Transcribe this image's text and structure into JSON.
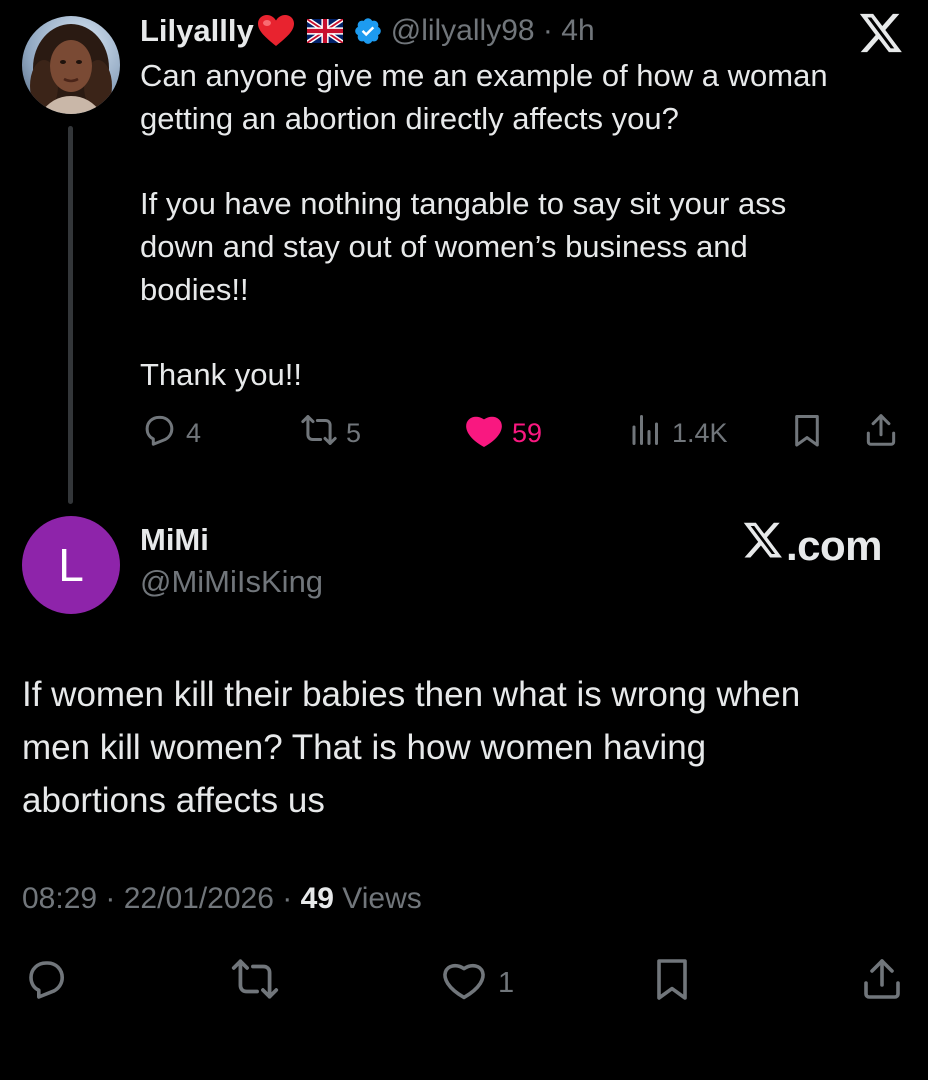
{
  "parent": {
    "display_name": "Lilyallly",
    "handle": "@lilyally98",
    "separator": "·",
    "time": "4h",
    "text_lines": [
      "Can anyone give me an example of how a woman",
      "getting an abortion directly affects you?",
      "If you have nothing tangable to say sit your ass",
      "down and stay out of women’s business and",
      "bodies!!",
      "Thank you!!"
    ],
    "replies": "4",
    "reposts": "5",
    "likes": "59",
    "views": "1.4K",
    "icons": {
      "verified": "verified-badge-icon",
      "flag": "uk-flag-icon",
      "heart": "red-heart-emoji-icon",
      "platform": "x-logo-icon"
    }
  },
  "reply": {
    "avatar_letter": "L",
    "display_name": "MiMi",
    "handle": "@MiMiIsKing",
    "watermark": ".com",
    "text_lines": [
      "If women kill their babies then what is wrong when",
      "men kill women? That is how women having",
      "abortions affects us"
    ],
    "time": "08:29",
    "date": "22/01/2026",
    "views_count": "49",
    "views_label": "Views",
    "likes": "1"
  },
  "colors": {
    "background": "#000000",
    "text": "#e7e9ea",
    "muted": "#71767b",
    "like_pink": "#f91880",
    "verified_blue": "#1d9bf0",
    "avatar_purple": "#8e24aa"
  }
}
